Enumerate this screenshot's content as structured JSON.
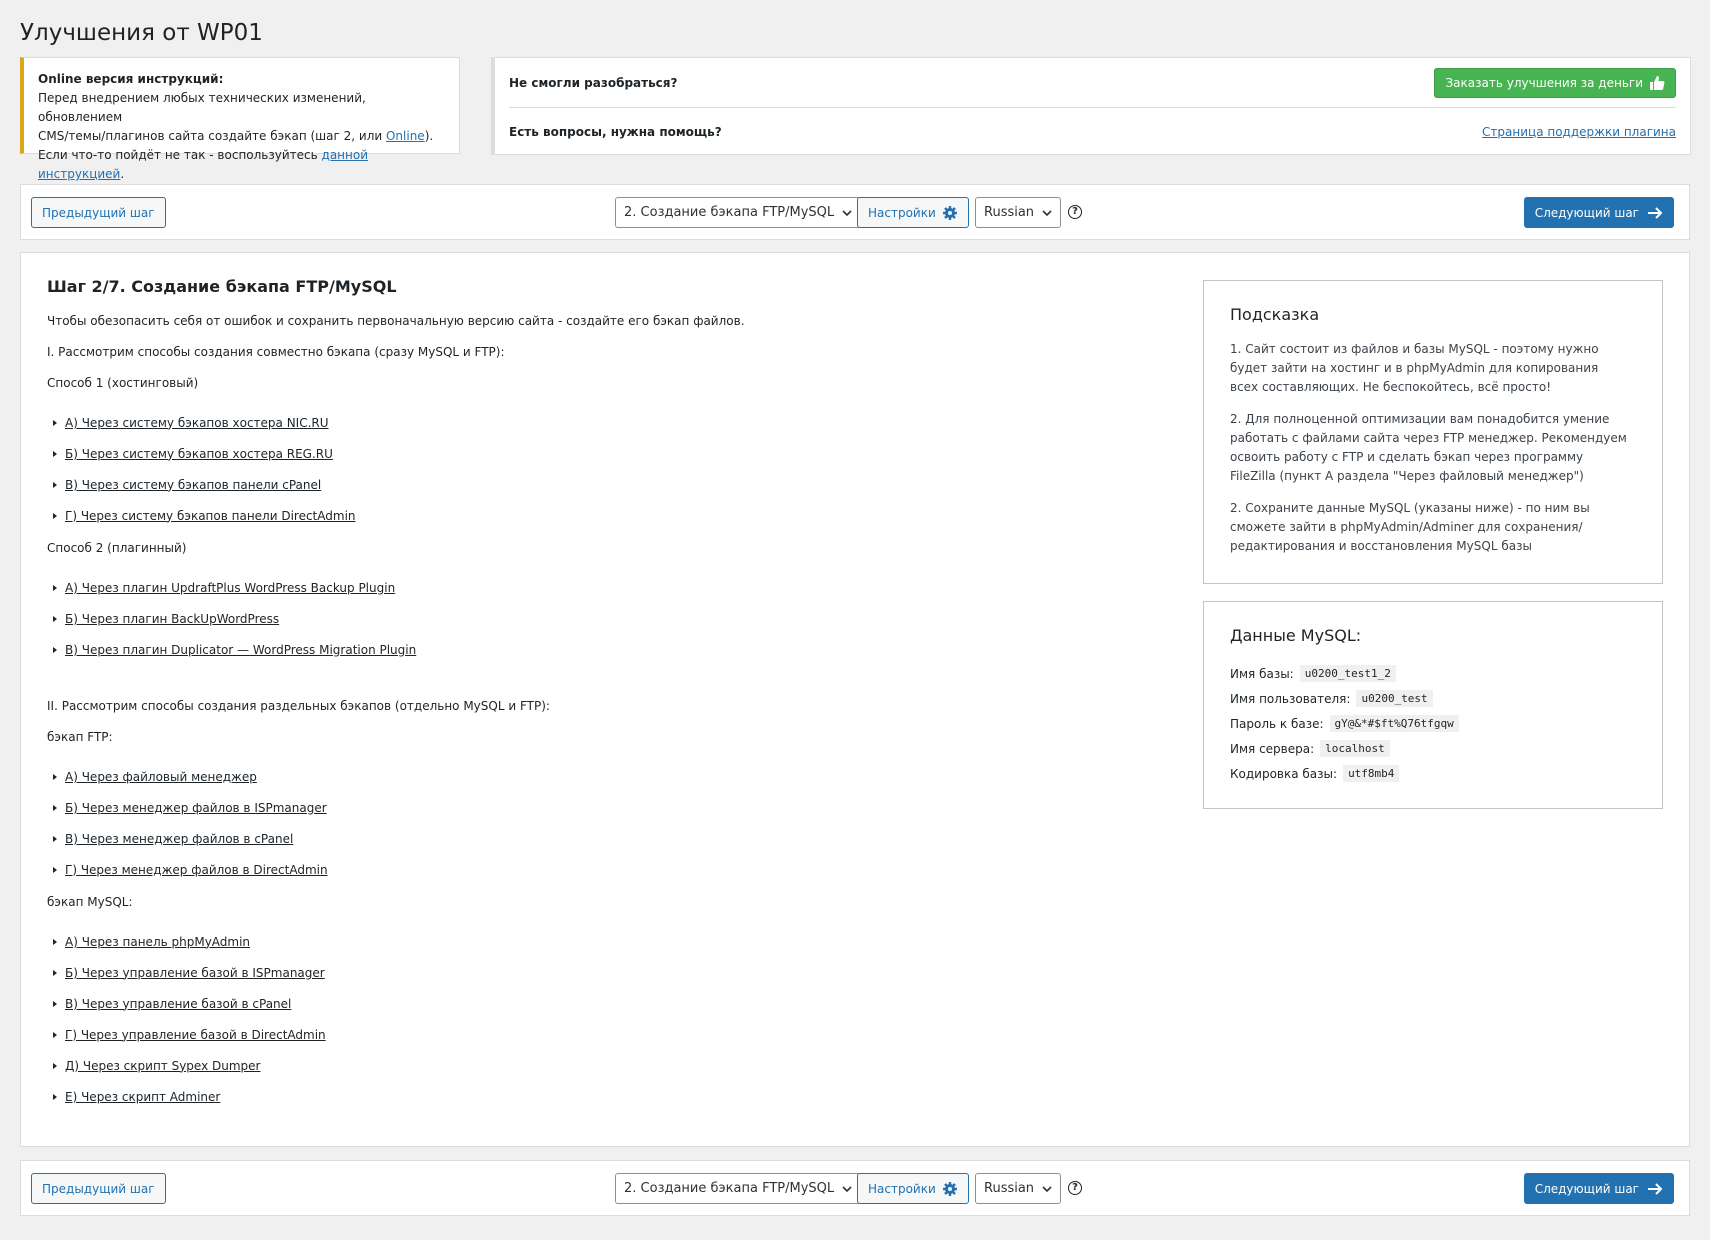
{
  "page": {
    "title": "Улучшения от WP01"
  },
  "notice": {
    "heading": "Online версия инструкций:",
    "line1": "Перед внедрением любых технических изменений, обновлением",
    "line2_prefix": "CMS/темы/плагинов сайта создайте бэкап (шаг 2, или ",
    "line2_link": "Online",
    "line2_suffix": ").",
    "line3_prefix": "Если что-то пойдёт не так - воспользуйтесь ",
    "line3_link": "данной инструкцией",
    "line3_suffix": "."
  },
  "help": {
    "q1": "Не смогли разобраться?",
    "order_button": "Заказать улучшения за деньги",
    "q2": "Есть вопросы, нужна помощь?",
    "support_link": "Страница поддержки плагина"
  },
  "nav": {
    "prev": "Предыдущий шаг",
    "step_select": "2. Создание бэкапа FTP/MySQL",
    "settings": "Настройки",
    "language": "Russian",
    "help_icon": "?",
    "next": "Следующий шаг"
  },
  "main": {
    "heading": "Шаг 2/7. Создание бэкапа FTP/MySQL",
    "intro": "Чтобы обезопасить себя от ошибок и сохранить первоначальную версию сайта - создайте его бэкап файлов.",
    "section1": "I. Рассмотрим способы создания совместно бэкапа (сразу MySQL и FTP):",
    "method1": "Способ 1 (хостинговый)",
    "method1_items": [
      "А) Через систему бэкапов хостера NIC.RU",
      "Б) Через систему бэкапов хостера REG.RU",
      "В) Через систему бэкапов панели cPanel",
      "Г) Через систему бэкапов панели DirectAdmin"
    ],
    "method2": "Способ 2 (плагинный)",
    "method2_items": [
      "А) Через плагин UpdraftPlus WordPress Backup Plugin",
      "Б) Через плагин BackUpWordPress",
      "В) Через плагин Duplicator — WordPress Migration Plugin"
    ],
    "section2": "II. Рассмотрим способы создания раздельных бэкапов (отдельно MySQL и FTP):",
    "ftp": "бэкап FTP:",
    "ftp_items": [
      "А) Через файловый менеджер",
      "Б) Через менеджер файлов в ISPmanager",
      "В) Через менеджер файлов в cPanel",
      "Г) Через менеджер файлов в DirectAdmin"
    ],
    "mysql": "бэкап MySQL:",
    "mysql_items": [
      "А) Через панель phpMyAdmin",
      "Б) Через управление базой в ISPmanager",
      "В) Через управление базой в cPanel",
      "Г) Через управление базой в DirectAdmin",
      "Д) Через скрипт Sypex Dumper",
      "Е) Через скрипт Adminer"
    ]
  },
  "hint": {
    "title": "Подсказка",
    "p1": "1. Сайт состоит из файлов и базы MySQL - поэтому нужно будет зайти на хостинг и в phpMyAdmin для копирования всех составляющих. Не беспокойтесь, всё просто!",
    "p2": "2. Для полноценной оптимизации вам понадобится умение работать с файлами сайта через FTP менеджер. Рекомендуем освоить работу с FTP и сделать бэкап через программу FileZilla (пункт А раздела \"Через файловый менеджер\")",
    "p3": "2. Сохраните данные MySQL (указаны ниже) - по ним вы сможете зайти в phpMyAdmin/Adminer для сохранения/редактирования и восстановления MySQL базы"
  },
  "mysql_data": {
    "title": "Данные MySQL:",
    "rows": [
      {
        "label": "Имя базы:",
        "value": "u0200_test1_2"
      },
      {
        "label": "Имя пользователя:",
        "value": "u0200_test"
      },
      {
        "label": "Пароль к базе:",
        "value": "gY@&*#$ft%Q76tfgqw"
      },
      {
        "label": "Имя сервера:",
        "value": "localhost"
      },
      {
        "label": "Кодировка базы:",
        "value": "utf8mb4"
      }
    ]
  },
  "colors": {
    "accent": "#2271b1",
    "green": "#46b450",
    "warning": "#dba617"
  }
}
